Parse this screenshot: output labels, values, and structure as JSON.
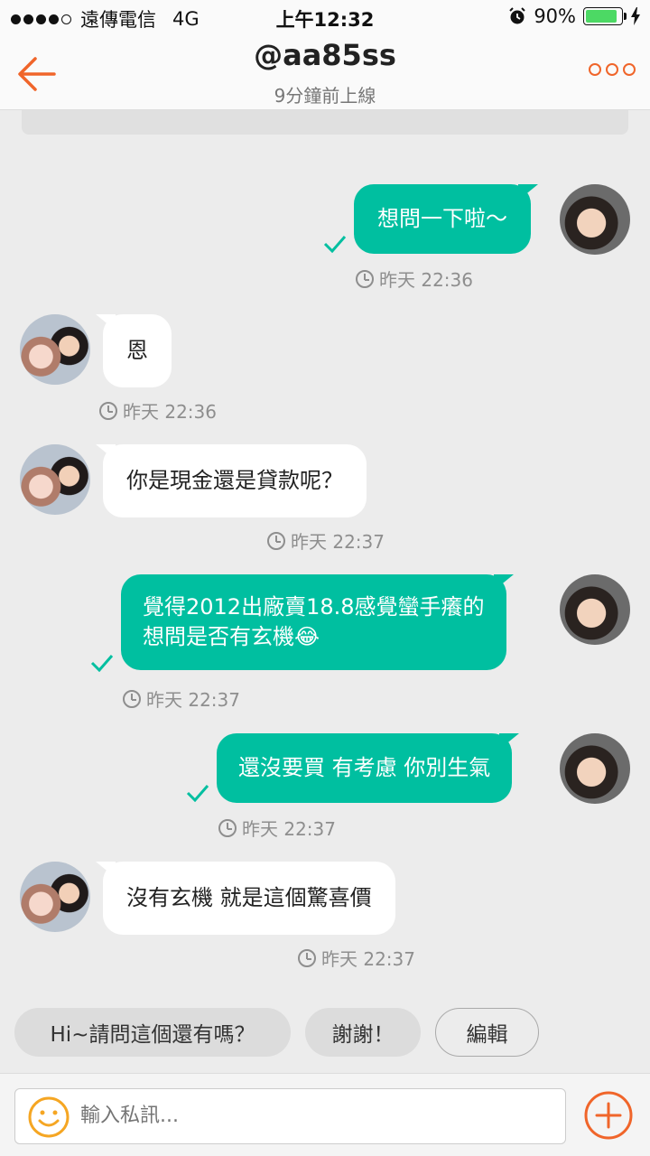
{
  "status_bar": {
    "carrier": "遠傳電信",
    "network": "4G",
    "time": "上午12:32",
    "battery": "90%",
    "battery_level": 0.9
  },
  "header": {
    "title": "@aa85ss",
    "subtitle": "9分鐘前上線"
  },
  "messages": [
    {
      "sender": "me",
      "text": "想問一下啦～",
      "time": "昨天 22:36",
      "status": "sent"
    },
    {
      "sender": "other",
      "text": "恩",
      "time": "昨天 22:36"
    },
    {
      "sender": "other",
      "text": "你是現金還是貸款呢？",
      "time": "昨天 22:37"
    },
    {
      "sender": "me",
      "lines": [
        "覺得2012出廠賣18.8感覺蠻手癢的",
        "想問是否有玄機😂"
      ],
      "time": "昨天 22:37",
      "status": "sent"
    },
    {
      "sender": "me",
      "text": "還沒要買 有考慮 你別生氣",
      "time": "昨天 22:37",
      "status": "sent"
    },
    {
      "sender": "other",
      "text": "沒有玄機 就是這個驚喜價",
      "time": "昨天 22:37"
    }
  ],
  "quick_replies": [
    "Hi~請問這個還有嗎？",
    "謝謝！",
    "編輯"
  ],
  "input": {
    "placeholder": "輸入私訊..."
  },
  "colors": {
    "accent": "#f0652a",
    "bubble_me": "#00bfa0",
    "bubble_other": "#ffffff",
    "background": "#ececec"
  },
  "icons": {
    "back": "arrow-left-icon",
    "more": "more-dots-icon",
    "emoji": "smiley-icon",
    "attach": "plus-circle-icon",
    "time": "clock-icon",
    "read": "check-icon"
  }
}
